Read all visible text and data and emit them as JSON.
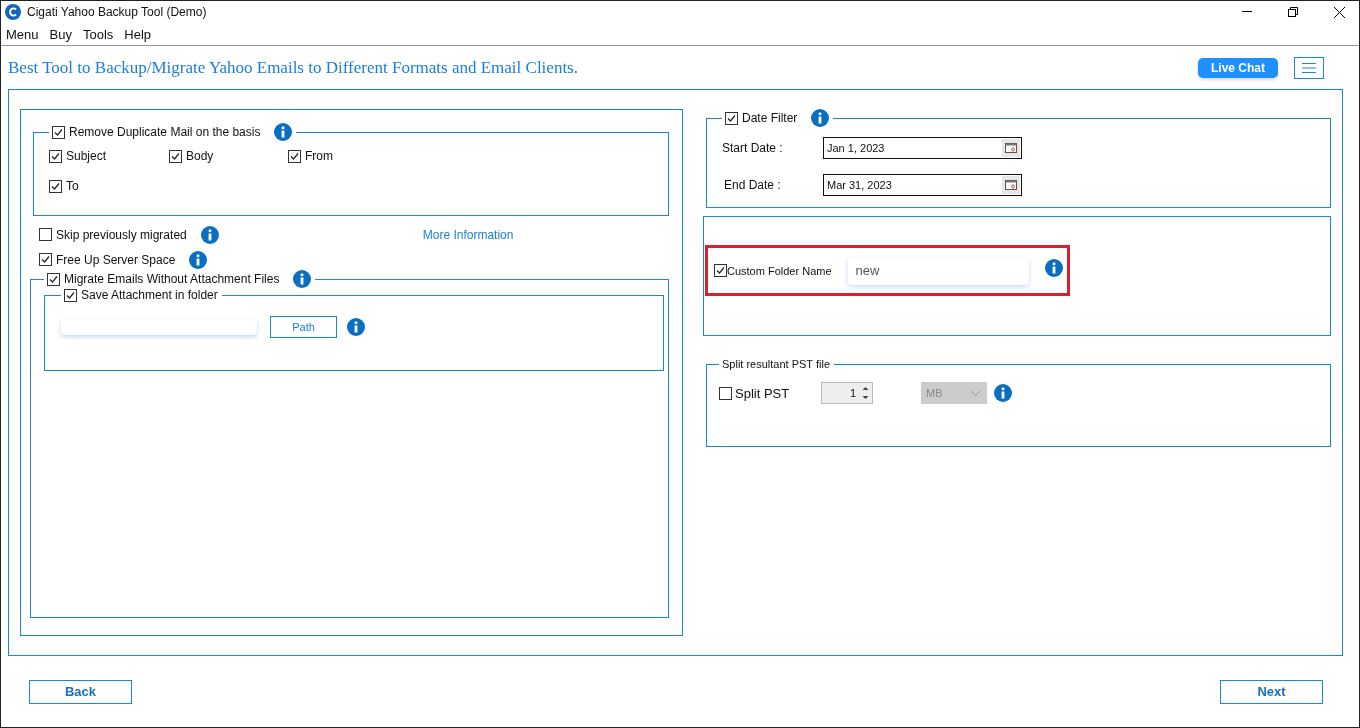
{
  "window": {
    "title": "Cigati Yahoo Backup Tool (Demo)"
  },
  "menu": [
    "Menu",
    "Buy",
    "Tools",
    "Help"
  ],
  "header": {
    "tagline": "Best Tool to Backup/Migrate Yahoo Emails to Different Formats and Email Clients.",
    "live_chat": "Live Chat"
  },
  "duplicate_filter": {
    "label": "Remove Duplicate Mail on the basis",
    "checked": true,
    "fields": [
      {
        "label": "Subject",
        "checked": true
      },
      {
        "label": "Body",
        "checked": true
      },
      {
        "label": "From",
        "checked": true
      },
      {
        "label": "To",
        "checked": true
      }
    ]
  },
  "options": [
    {
      "label": "Skip previously migrated",
      "checked": false
    },
    {
      "label": "Free Up Server Space",
      "checked": true
    }
  ],
  "more_information": "More Information",
  "attachments": {
    "label": "Migrate Emails Without Attachment Files",
    "checked": true,
    "save_label": "Save Attachment in folder",
    "save_checked": true,
    "path_button": "Path"
  },
  "date_filter": {
    "label": "Date Filter",
    "checked": true,
    "start_label": "Start Date :",
    "start_value": "Jan 1, 2023",
    "end_label": "End Date :",
    "end_value": "Mar 31, 2023"
  },
  "custom_folder": {
    "label": "Custom Folder Name",
    "checked": true,
    "value": "new",
    "highlighted": true
  },
  "split": {
    "title": "Split resultant PST file",
    "label": "Split PST",
    "checked": false,
    "size": "1",
    "unit": "MB",
    "disabled": true
  },
  "buttons": {
    "back": "Back",
    "next": "Next"
  }
}
